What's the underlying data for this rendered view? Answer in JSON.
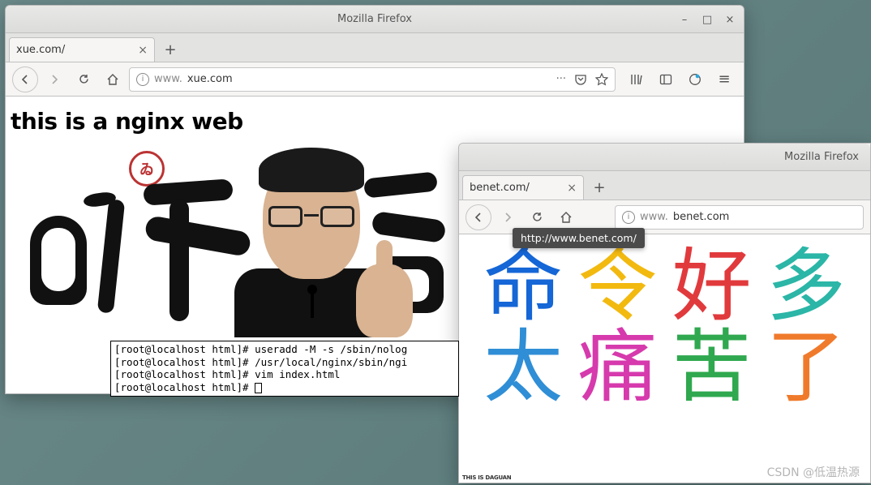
{
  "window1": {
    "title": "Mozilla Firefox",
    "tab_label": "xue.com/",
    "url_display_prefix": "www.",
    "url_display_host": "xue.com",
    "page_heading": "this is a nginx web"
  },
  "window2": {
    "title": "Mozilla Firefox",
    "tab_label": "benet.com/",
    "url_display_prefix": "www.",
    "url_display_host": "benet.com",
    "tooltip": "http://www.benet.com/",
    "chars": [
      "命",
      "令",
      "好",
      "多",
      "太",
      "痛",
      "苦",
      "了"
    ],
    "char_colors": [
      "#1566d6",
      "#f2b90f",
      "#e13a3d",
      "#2bb6a7",
      "#2f8ed6",
      "#d63aad",
      "#2fa84f",
      "#f07a2b"
    ],
    "footer_tiny": "THIS IS DAGUAN"
  },
  "terminal": {
    "prompt": "[root@localhost html]# ",
    "lines": [
      "useradd -M -s /sbin/nolog",
      "/usr/local/nginx/sbin/ngi",
      "vim index.html",
      ""
    ]
  },
  "icons": {
    "minimize": "–",
    "maximize": "□",
    "close": "×",
    "newtab": "+",
    "more": "···",
    "menu": "≡"
  },
  "watermark": "CSDN @低温热源"
}
